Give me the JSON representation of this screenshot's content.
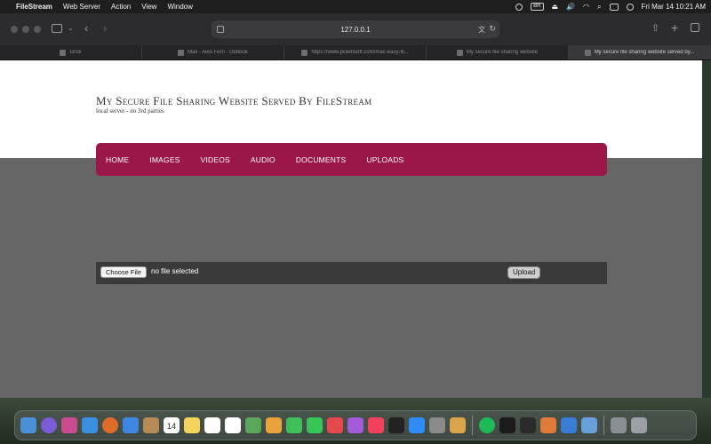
{
  "menubar": {
    "app_name": "FileStream",
    "menus": [
      "Web Server",
      "Action",
      "View",
      "Window"
    ],
    "input_badge": "BR",
    "datetime": "Fri Mar 14  10:21 AM"
  },
  "browser": {
    "url": "127.0.0.1",
    "tabs": [
      {
        "label": "Grok"
      },
      {
        "label": "Mail - Alex Ferri - Outlook"
      },
      {
        "label": "https://www.pcwinsoft.com/mac-easy-fil..."
      },
      {
        "label": "My secure file sharing website"
      },
      {
        "label": "My secure file sharing website served by..."
      }
    ]
  },
  "site": {
    "title": "My Secure File Sharing Website Served By FileStream",
    "subtitle": "local server - no 3rd parties",
    "nav": [
      "HOME",
      "IMAGES",
      "VIDEOS",
      "AUDIO",
      "DOCUMENTS",
      "UPLOADS"
    ],
    "accent_color": "#9b174a"
  },
  "upload": {
    "choose_label": "Choose File",
    "status": "no file selected",
    "button_label": "Upload"
  },
  "dock": {
    "calendar_day": "14",
    "apps": [
      "finder-icon",
      "siri-icon",
      "launchpad-icon",
      "safari-icon",
      "firefox-icon",
      "mail-icon",
      "contacts-icon",
      "calendar-icon",
      "notes-icon",
      "freeform-icon",
      "reminders-icon",
      "maps-icon",
      "photos-icon",
      "messages-icon",
      "facetime-icon",
      "news-icon",
      "podcasts-icon",
      "music-icon",
      "tv-icon",
      "app-store-icon",
      "system-settings-icon",
      "preview-icon",
      "spotify-icon",
      "terminal-icon",
      "activity-monitor-icon",
      "pixelmator-icon",
      "xcode-icon",
      "filestream-icon",
      "downloads-stack-icon",
      "trash-icon"
    ]
  }
}
